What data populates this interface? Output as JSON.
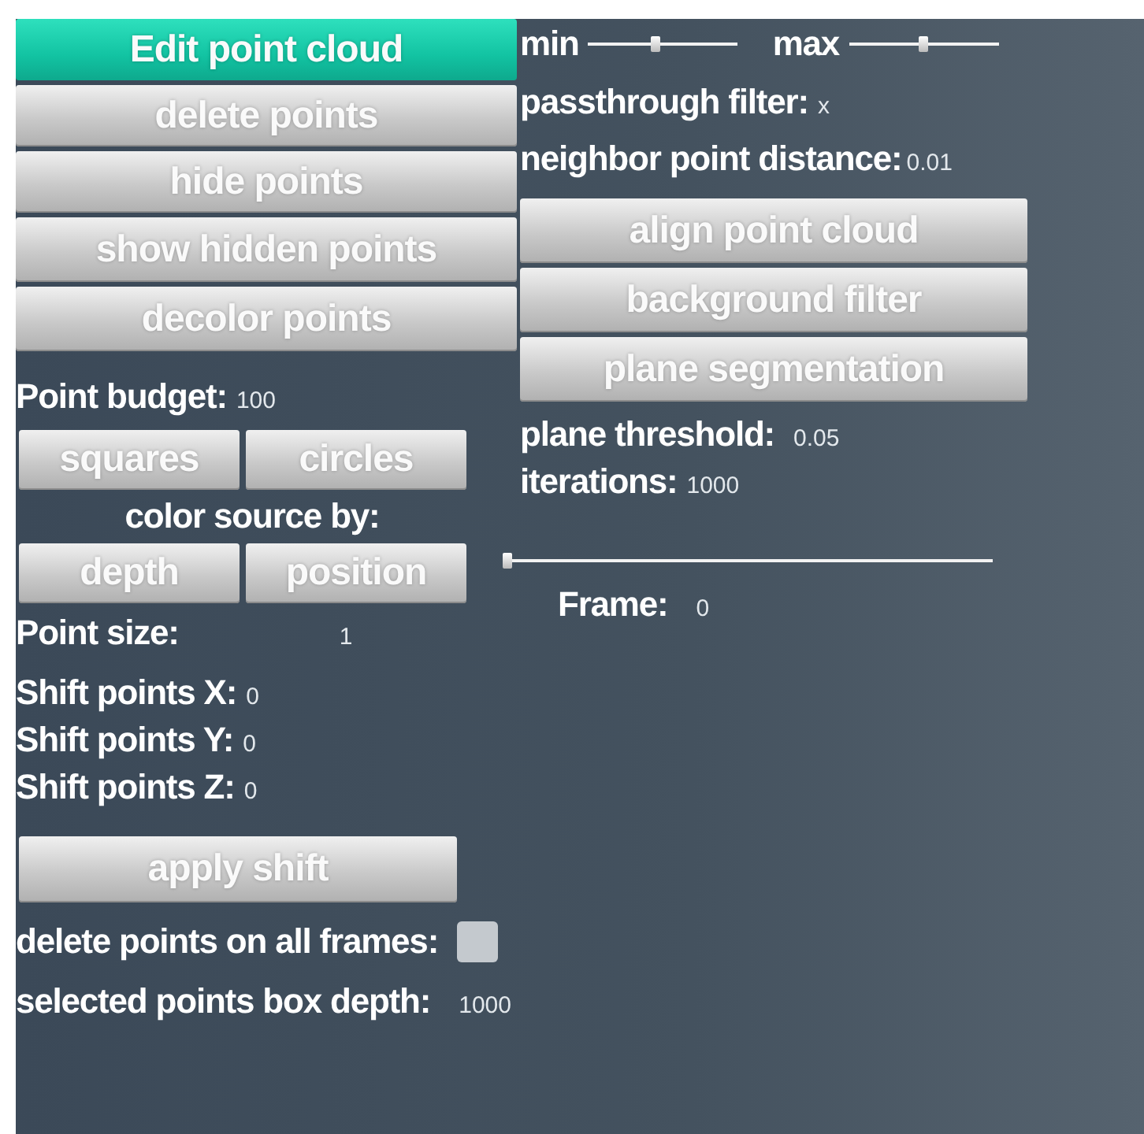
{
  "actions": [
    {
      "label": "Edit point cloud",
      "selected": true
    },
    {
      "label": "delete points",
      "selected": false
    },
    {
      "label": "hide points",
      "selected": false
    },
    {
      "label": "show hidden points",
      "selected": false
    },
    {
      "label": "decolor points",
      "selected": false
    }
  ],
  "point_budget": {
    "label": "Point budget:",
    "value": "100"
  },
  "point_shape": [
    {
      "label": "squares",
      "selected": false
    },
    {
      "label": "circles",
      "selected": false
    }
  ],
  "color_source_label": "color source by:",
  "color_source": [
    {
      "label": "depth",
      "selected": false
    },
    {
      "label": "position",
      "selected": false
    }
  ],
  "point_size": {
    "label": "Point size:",
    "value": "1"
  },
  "shift": [
    {
      "label": "Shift points X:",
      "value": "0"
    },
    {
      "label": "Shift points Y:",
      "value": "0"
    },
    {
      "label": "Shift points Z:",
      "value": "0"
    }
  ],
  "apply_shift": {
    "label": "apply shift"
  },
  "delete_all_frames": {
    "label": "delete points on all frames:",
    "checked": false
  },
  "box_depth": {
    "label": "selected points box depth:",
    "value": "1000"
  },
  "range": [
    {
      "label": "min",
      "level": 0.45
    },
    {
      "label": "max",
      "level": 0.5
    }
  ],
  "passthrough": {
    "label": "passthrough filter:",
    "value": "x"
  },
  "neighbor_distance": {
    "label": "neighbor point distance:",
    "value": "0.01"
  },
  "tools": [
    {
      "label": "align point cloud"
    },
    {
      "label": "background filter"
    },
    {
      "label": "plane segmentation"
    }
  ],
  "plane_threshold": {
    "label": "plane threshold:",
    "value": "0.05"
  },
  "iterations": {
    "label": "iterations:",
    "value": "1000"
  },
  "frame_slider": {
    "level": 0
  },
  "frame": {
    "label": "Frame:",
    "value": "0"
  }
}
